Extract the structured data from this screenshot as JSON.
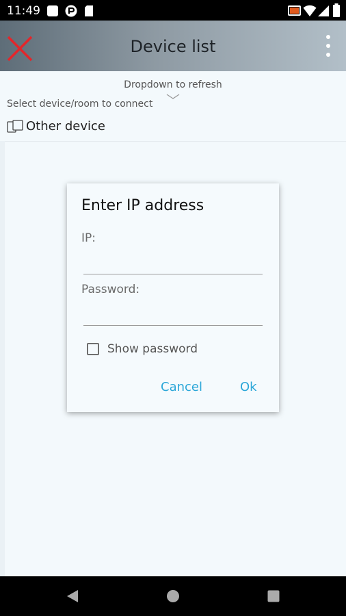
{
  "status_bar": {
    "time": "11:49",
    "left_icons": [
      "notification-icon",
      "app-notification-icon",
      "sd-card-icon"
    ],
    "right_icons": [
      "cast-icon",
      "wifi-icon",
      "signal-icon",
      "battery-icon"
    ]
  },
  "app_bar": {
    "title": "Device list",
    "close_icon": "close-icon",
    "menu_icon": "more-vert-icon",
    "close_color": "#e3262b"
  },
  "list": {
    "refresh_hint": "Dropdown to refresh",
    "select_label": "Select device/room to connect",
    "items": [
      {
        "label": "Other device",
        "icon": "device-icon"
      }
    ]
  },
  "dialog": {
    "title": "Enter IP address",
    "ip_label": "IP:",
    "ip_value": "",
    "password_label": "Password:",
    "password_value": "",
    "show_password_label": "Show password",
    "show_password_checked": false,
    "cancel_label": "Cancel",
    "ok_label": "Ok",
    "accent_color": "#2aa6d8"
  },
  "nav_bar": {
    "back_icon": "back-icon",
    "home_icon": "home-icon",
    "recents_icon": "recents-icon"
  }
}
